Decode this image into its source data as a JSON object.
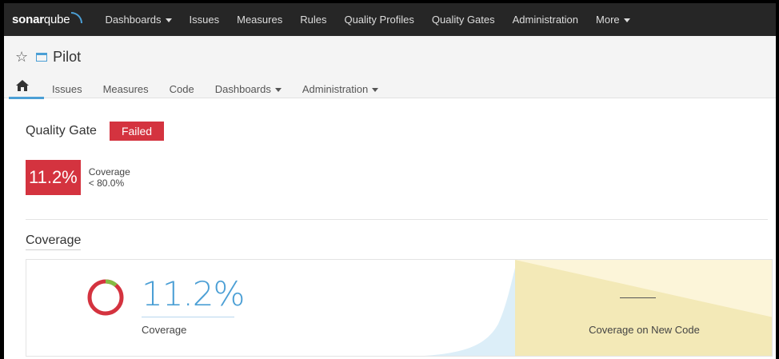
{
  "topnav": {
    "logo_bold": "sonar",
    "logo_light": "qube",
    "items": [
      {
        "label": "Dashboards",
        "dropdown": true
      },
      {
        "label": "Issues",
        "dropdown": false
      },
      {
        "label": "Measures",
        "dropdown": false
      },
      {
        "label": "Rules",
        "dropdown": false
      },
      {
        "label": "Quality Profiles",
        "dropdown": false
      },
      {
        "label": "Quality Gates",
        "dropdown": false
      },
      {
        "label": "Administration",
        "dropdown": false
      },
      {
        "label": "More",
        "dropdown": true
      }
    ]
  },
  "project": {
    "name": "Pilot",
    "tabs": [
      {
        "label": "Issues"
      },
      {
        "label": "Measures"
      },
      {
        "label": "Code"
      },
      {
        "label": "Dashboards"
      },
      {
        "label": "Administration"
      }
    ]
  },
  "quality_gate": {
    "label": "Quality Gate",
    "status": "Failed",
    "condition": {
      "value": "11.2%",
      "metric": "Coverage",
      "threshold": "< 80.0%"
    }
  },
  "coverage": {
    "section_title": "Coverage",
    "value": "11.2%",
    "value_fraction": 0.112,
    "label": "Coverage",
    "new_code_value": "—",
    "new_code_label": "Coverage on New Code"
  },
  "colors": {
    "failed": "#d4333f",
    "accent": "#4b9fd5",
    "covered": "#85bb43",
    "new_code_bg": "#f3e9b7"
  }
}
